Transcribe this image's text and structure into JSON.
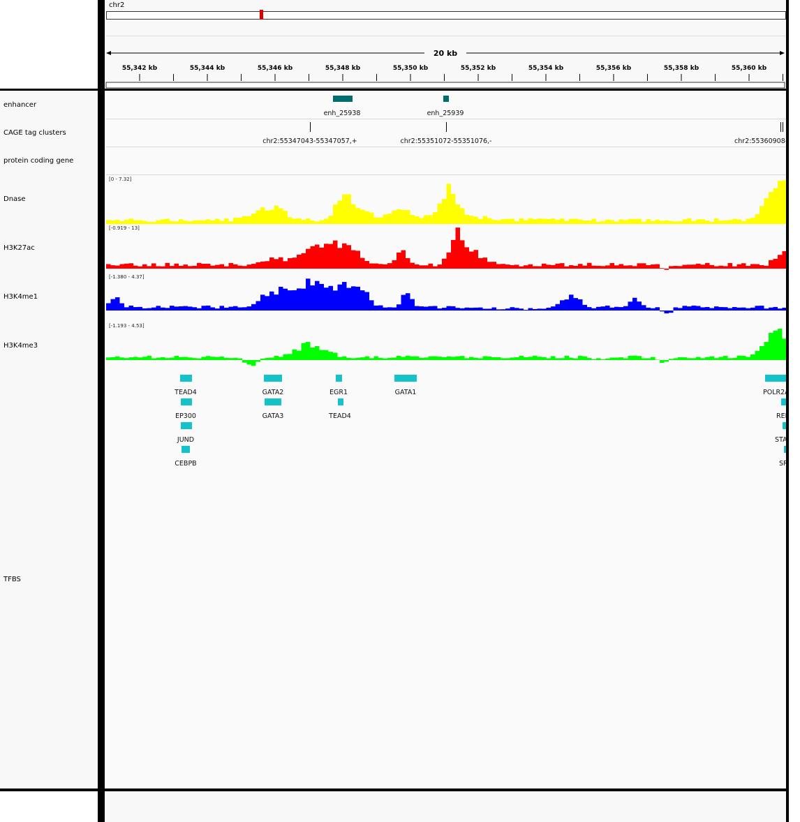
{
  "locus": {
    "chromosome": "chr2",
    "scale_label": "20 kb"
  },
  "ruler": {
    "ticks": [
      "55,342 kb",
      "55,344 kb",
      "55,346 kb",
      "55,348 kb",
      "55,350 kb",
      "55,352 kb",
      "55,354 kb",
      "55,356 kb",
      "55,358 kb",
      "55,360 kb"
    ]
  },
  "tracks": {
    "enhancer": {
      "label": "enhancer",
      "features": [
        "enh_25938",
        "enh_25939"
      ]
    },
    "cage": {
      "label": "CAGE tag clusters",
      "features": [
        "chr2:55347043-55347057,+",
        "chr2:55351072-55351076,-",
        "chr2:55360908-"
      ]
    },
    "protein": {
      "label": "protein coding gene"
    },
    "dnase": {
      "label": "Dnase",
      "range": "[0 - 7.32]",
      "color": "#ffff00"
    },
    "h3k27ac": {
      "label": "H3K27ac",
      "range": "[-0.919 - 13]",
      "color": "#ff0000"
    },
    "h3k4me1": {
      "label": "H3K4me1",
      "range": "[-1.380 - 4.37]",
      "color": "#0000ff"
    },
    "h3k4me3": {
      "label": "H3K4me3",
      "range": "[-1.193 - 4.53]",
      "color": "#00ff00"
    },
    "tfbs": {
      "label": "TFBS",
      "color": "#14c2cc",
      "sites": [
        "TEAD4",
        "EP300",
        "JUND",
        "CEBPB",
        "GATA2",
        "GATA3",
        "EGR1",
        "TEAD4",
        "GATA1",
        "POLR2A",
        "REL",
        "STA",
        "SR"
      ]
    }
  }
}
